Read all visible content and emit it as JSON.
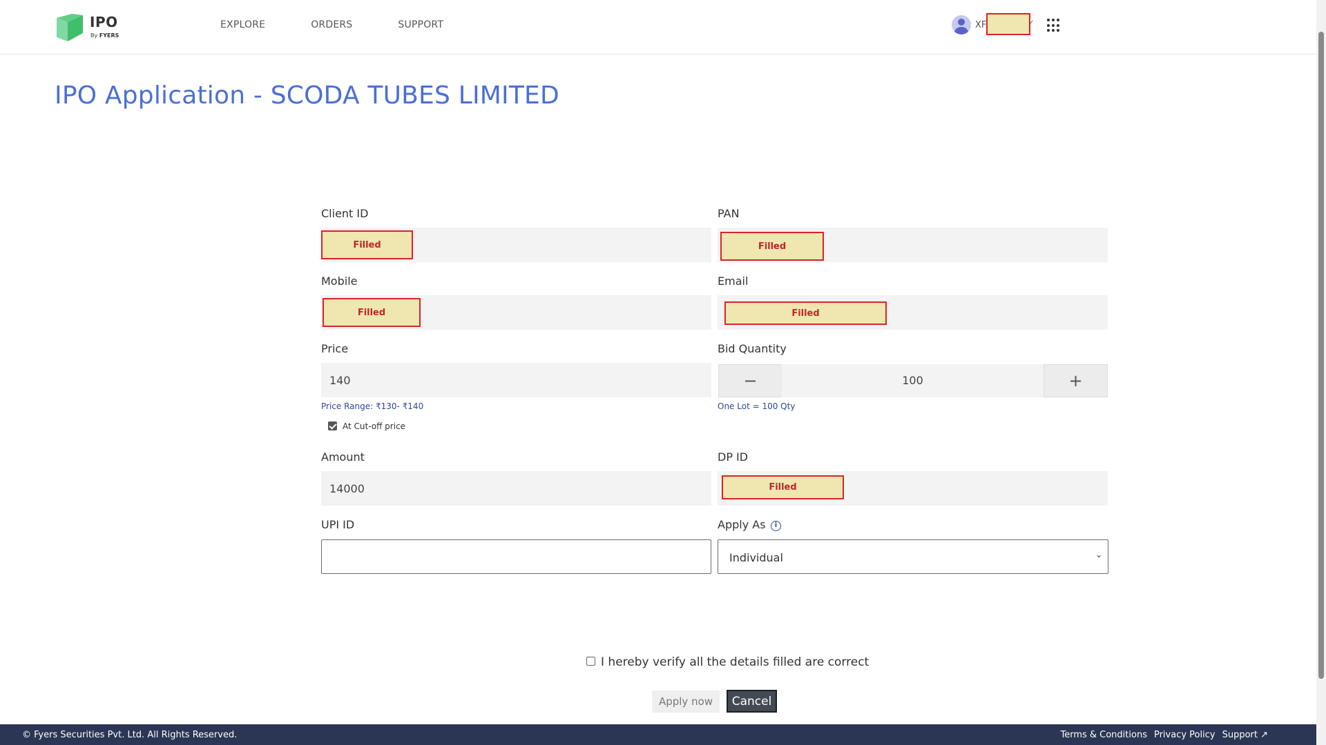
{
  "header": {
    "logo_title": "IPO",
    "logo_sub_prefix": "By",
    "logo_sub_brand": "FYERS",
    "nav": [
      "EXPLORE",
      "ORDERS",
      "SUPPORT"
    ],
    "user_initials": "XF"
  },
  "page_title": "IPO Application - SCODA TUBES LIMITED",
  "form": {
    "client_id_label": "Client ID",
    "client_id_value": "Filled",
    "pan_label": "PAN",
    "pan_value": "Filled",
    "mobile_label": "Mobile",
    "mobile_value": "Filled",
    "email_label": "Email",
    "email_value": "Filled",
    "price_label": "Price",
    "price_value": "140",
    "price_range": "Price Range: ₹130- ₹140",
    "cutoff_label": "At Cut-off price",
    "cutoff_checked": true,
    "bid_qty_label": "Bid Quantity",
    "bid_qty_value": "100",
    "bid_minus": "−",
    "bid_plus": "+",
    "lot_hint": "One Lot = 100 Qty",
    "amount_label": "Amount",
    "amount_value": "14000",
    "dp_id_label": "DP ID",
    "dp_id_value": "Filled",
    "upi_label": "UPI ID",
    "upi_value": "",
    "apply_as_label": "Apply As",
    "apply_as_value": "Individual"
  },
  "verify_text": "I hereby verify all the details filled are correct",
  "buttons": {
    "apply": "Apply now",
    "cancel": "Cancel"
  },
  "footer": {
    "copyright": "© Fyers Securities Pvt. Ltd. All Rights Reserved.",
    "links": [
      "Terms & Conditions",
      "Privacy Policy",
      "Support ↗"
    ]
  },
  "colors": {
    "title": "#4a6fd4",
    "hint": "#2d4a8f",
    "footer_bg": "#2a3654",
    "redact_border": "#d72424",
    "redact_fill": "#f0e6b0"
  }
}
